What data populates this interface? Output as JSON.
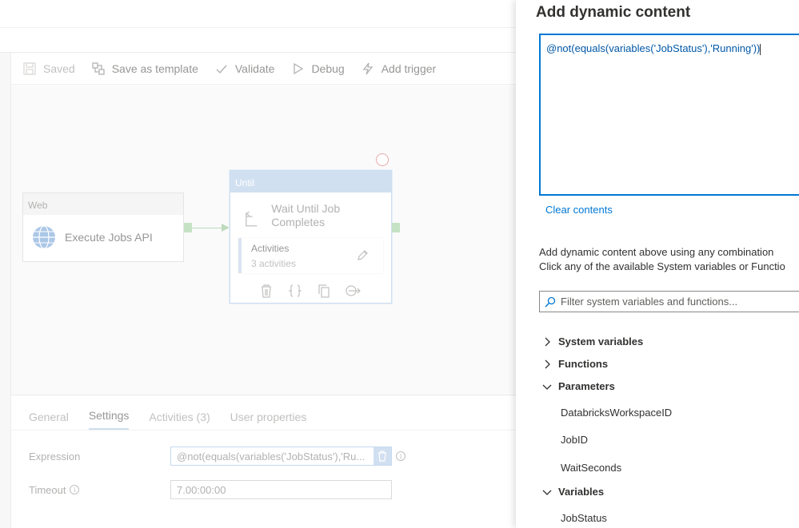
{
  "toolbar": {
    "saved_label": "Saved",
    "save_template_label": "Save as template",
    "validate_label": "Validate",
    "debug_label": "Debug",
    "add_trigger_label": "Add trigger"
  },
  "canvas": {
    "web_activity": {
      "type_label": "Web",
      "name": "Execute Jobs API"
    },
    "until_activity": {
      "type_label": "Until",
      "name": "Wait Until Job Completes",
      "activities_label": "Activities",
      "activities_count": "3 activities"
    }
  },
  "properties": {
    "tabs": [
      {
        "label": "General",
        "active": false
      },
      {
        "label": "Settings",
        "active": true
      },
      {
        "label": "Activities (3)",
        "active": false
      },
      {
        "label": "User properties",
        "active": false
      }
    ],
    "expression_label": "Expression",
    "expression_value": "@not(equals(variables('JobStatus'),'Ru...",
    "timeout_label": "Timeout",
    "timeout_value": "7.00:00:00"
  },
  "panel": {
    "title": "Add dynamic content",
    "expression": "@not(equals(variables('JobStatus'),'Running'))",
    "clear_label": "Clear contents",
    "help_line1": "Add dynamic content above using any combination",
    "help_line2": "Click any of the available System variables or Functio",
    "filter_placeholder": "Filter system variables and functions...",
    "sections": {
      "system_variables": "System variables",
      "functions": "Functions",
      "parameters": "Parameters",
      "variables": "Variables"
    },
    "parameters": [
      "DatabricksWorkspaceID",
      "JobID",
      "WaitSeconds"
    ],
    "variables": [
      "JobStatus"
    ]
  },
  "colors": {
    "accent": "#0078d4",
    "until_header": "#b9cfea",
    "connector": "#a6d3a6"
  }
}
